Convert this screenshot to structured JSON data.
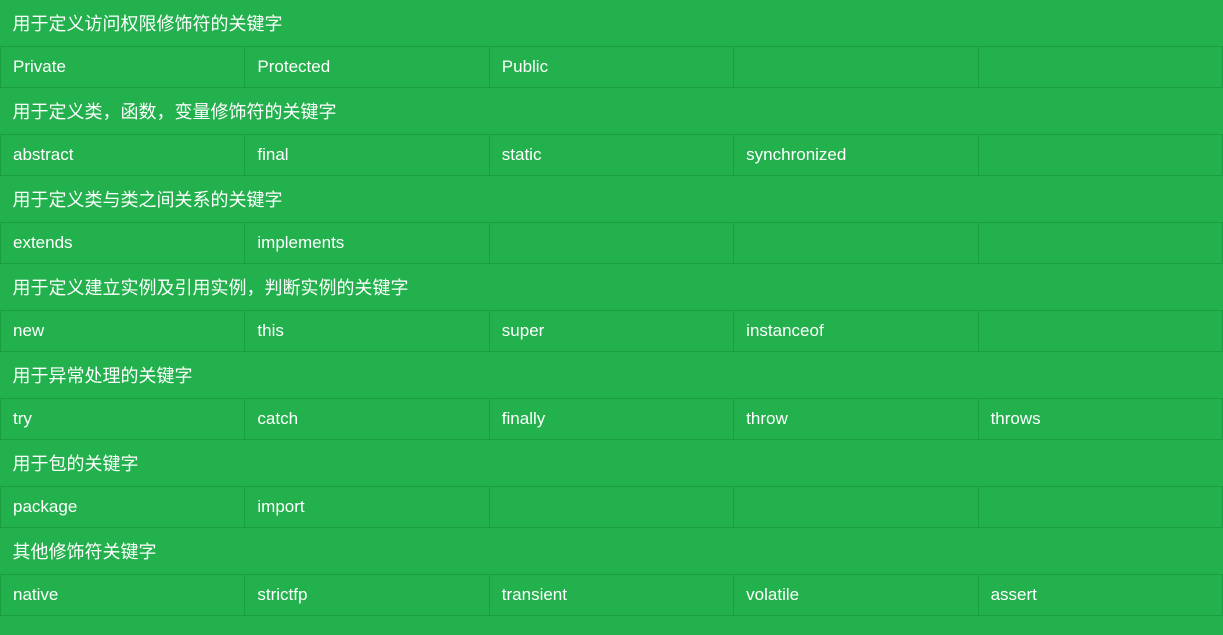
{
  "page": {
    "sections": [
      {
        "header": "用于定义访问权限修饰符的关键字",
        "rows": [
          [
            "Private",
            "Protected",
            "Public",
            "",
            ""
          ]
        ]
      },
      {
        "header": "用于定义类，函数，变量修饰符的关键字",
        "rows": [
          [
            "abstract",
            "final",
            "static",
            "synchronized",
            ""
          ]
        ]
      },
      {
        "header": "用于定义类与类之间关系的关键字",
        "rows": [
          [
            "extends",
            "implements",
            "",
            "",
            ""
          ]
        ]
      },
      {
        "header": "用于定义建立实例及引用实例，判断实例的关键字",
        "rows": [
          [
            "new",
            "this",
            "super",
            "instanceof",
            ""
          ]
        ]
      },
      {
        "header": "用于异常处理的关键字",
        "rows": [
          [
            "try",
            "catch",
            "finally",
            "throw",
            "throws"
          ]
        ]
      },
      {
        "header": "用于包的关键字",
        "rows": [
          [
            "package",
            "import",
            "",
            "",
            ""
          ]
        ]
      },
      {
        "header": "其他修饰符关键字",
        "rows": [
          [
            "native",
            "strictfp",
            "transient",
            "volatile",
            "assert"
          ]
        ]
      }
    ]
  }
}
